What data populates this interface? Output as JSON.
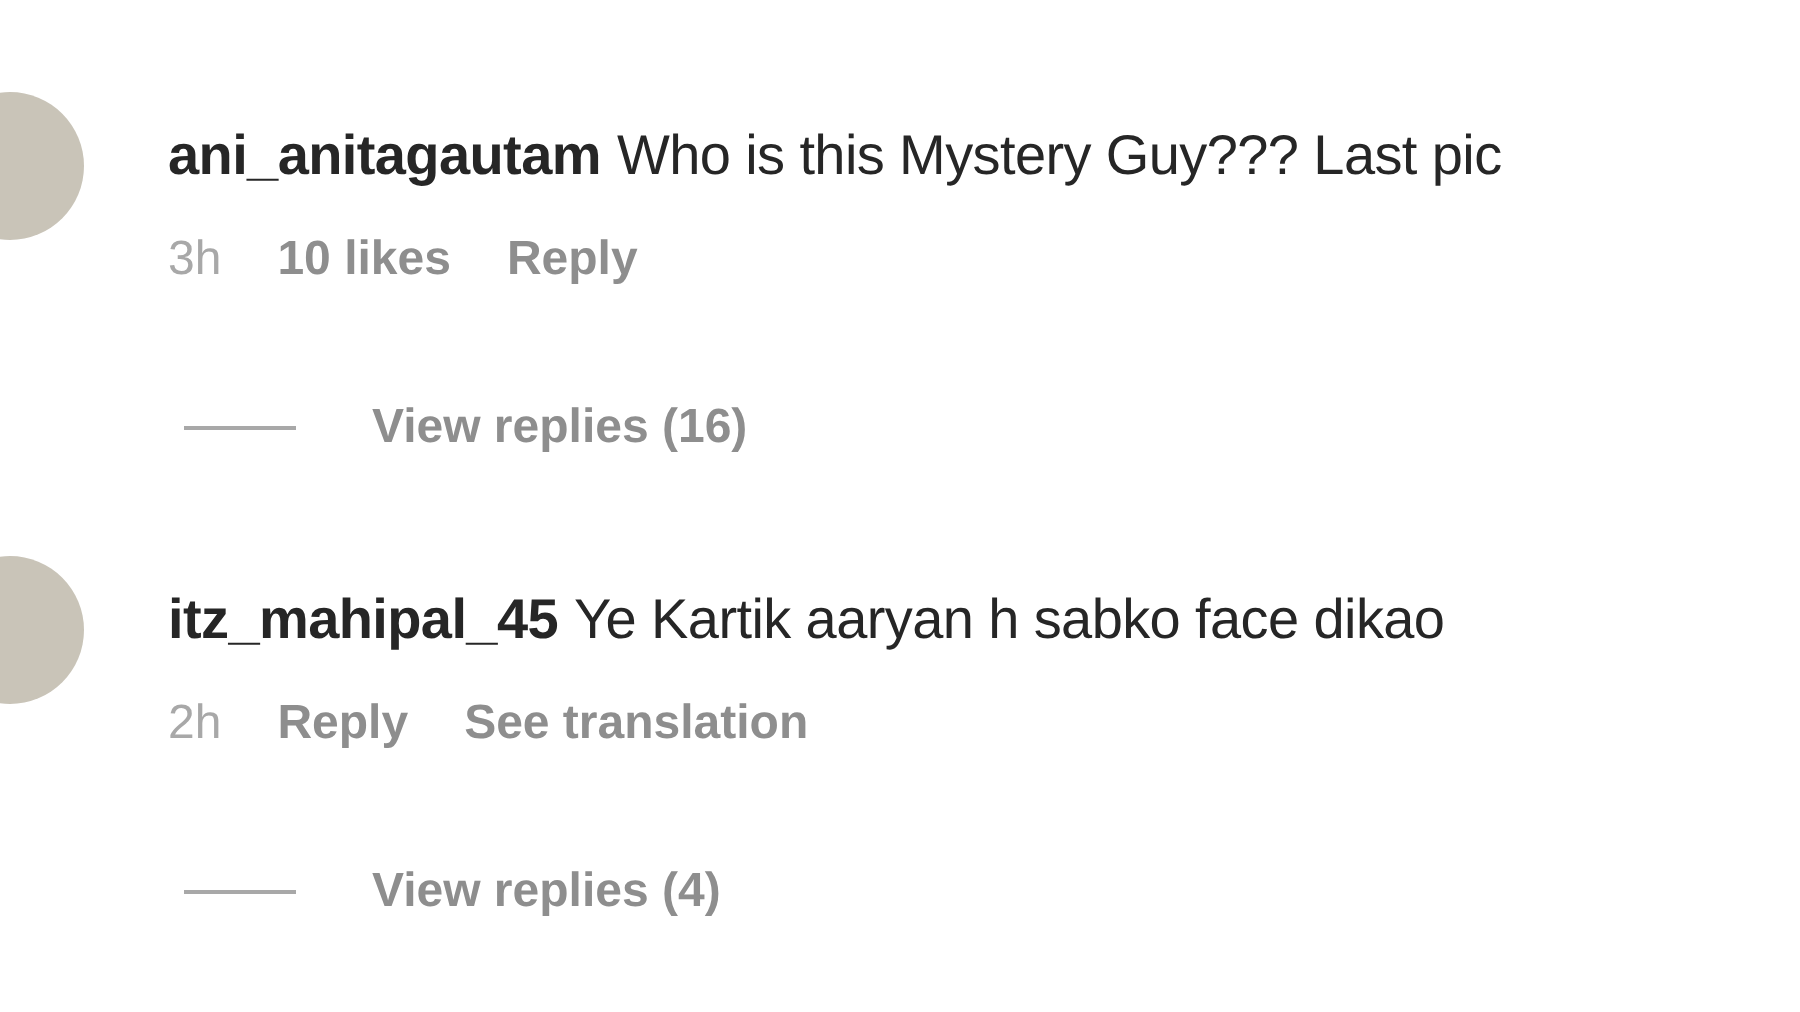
{
  "comments": [
    {
      "username": "ani_anitagautam",
      "text": "Who is this Mystery Guy??? Last pic",
      "meta": [
        {
          "kind": "time",
          "text": "3h"
        },
        {
          "kind": "action",
          "text": "10 likes"
        },
        {
          "kind": "action",
          "text": "Reply"
        }
      ],
      "view_replies": "View replies (16)"
    },
    {
      "username": "itz_mahipal_45",
      "text": "Ye Kartik aaryan h sabko face dikao",
      "meta": [
        {
          "kind": "time",
          "text": "2h"
        },
        {
          "kind": "action",
          "text": "Reply"
        },
        {
          "kind": "action",
          "text": "See translation"
        }
      ],
      "view_replies": "View replies (4)"
    }
  ]
}
